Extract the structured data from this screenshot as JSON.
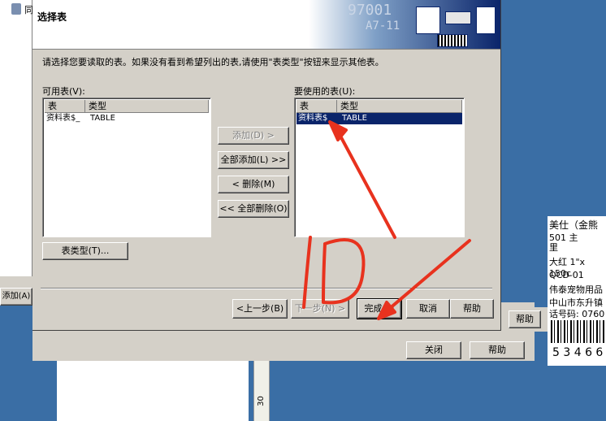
{
  "background_window": {
    "toolbar_text": "同",
    "add_button": "添加(A)",
    "close_button": "关闭",
    "help_button": "帮助",
    "help_button_right": "帮助",
    "ruler_number": "30"
  },
  "barcode_label": {
    "lines": [
      "美仕（金熊",
      "501      主",
      "里",
      "大红 1\"x 150c",
      "QCD-01",
      "伟泰宠物用品",
      "中山市东升镇",
      "话号码: 0760"
    ],
    "digits": "5 3 4 6 6"
  },
  "dialog": {
    "title": "选择表",
    "banner_text1": "97001",
    "banner_text2": "A7-11",
    "instruction": "请选择您要读取的表。如果没有看到希望列出的表,请使用\"表类型\"按钮来显示其他表。",
    "available_label": "可用表(V):",
    "selected_label": "要使用的表(U):",
    "columns": [
      "表",
      "类型"
    ],
    "available_rows": [
      {
        "table": "资料表$_",
        "type": "TABLE"
      }
    ],
    "selected_rows": [
      {
        "table": "资料表$",
        "type": "TABLE"
      }
    ],
    "buttons": {
      "add": "添加(D) >",
      "add_all": "全部添加(L) >>",
      "remove": "< 删除(M)",
      "remove_all": "<< 全部删除(O)",
      "table_types": "表类型(T)...",
      "back": "<上一步(B)",
      "next": "下一步(N) >",
      "finish": "完成(F)",
      "cancel": "取消",
      "help": "帮助"
    }
  },
  "annotation": {
    "handwriting": "1D",
    "color": "#e8321e"
  },
  "colors": {
    "dialog_face": "#d4d0c8",
    "selection": "#0a246a",
    "desktop": "#3a6ea5"
  }
}
